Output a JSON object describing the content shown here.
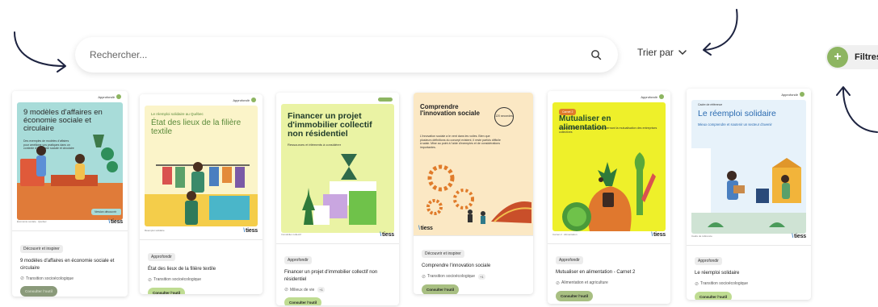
{
  "search": {
    "placeholder": "Rechercher..."
  },
  "sort": {
    "label": "Trier par"
  },
  "filters": {
    "label": "Filtres",
    "plus": "+"
  },
  "cards": [
    {
      "badge": "Approfondir",
      "cover_title": "9 modèles d'affaires en économie sociale et circulaire",
      "cover_sub": "Des exemples de modèles d'affaires pour améliorer vos pratiques dans un contexte d'économie sociale et circulaire",
      "cover_chip": "Version découvrir",
      "tag": "Découvrir et inspirer",
      "title": "9 modèles d'affaires en économie sociale et circulaire",
      "category": "Transition socioécologique",
      "cta": "Consulter l'outil"
    },
    {
      "badge": "Approfondir",
      "cover_kicker": "Le réemploi solidaire au Québec",
      "cover_title": "État des lieux de la filière textile",
      "tag": "Approfondir",
      "title": "État des lieux de la filière textile",
      "category": "Transition socioécologique",
      "cta": "Consulter l'outil"
    },
    {
      "cover_title": "Financer un projet d'immobilier collectif non résidentiel",
      "cover_sub": "Ressources et éléments à considérer",
      "tag": "Approfondir",
      "title": "Financer un projet d'immobilier collectif non résidentiel",
      "category": "Milieux de vie",
      "more": "+1",
      "cta": "Consulter l'outil"
    },
    {
      "cover_title": "Comprendre l'innovation sociale",
      "cover_stamp": "120 secondes",
      "cover_sub": "L'innovation sociale a le vent dans les voiles. Bien que plusieurs définitions du concept existent, il reste parfois difficile à saisir. Mise au point à l'aide d'exemples et de considérations importantes.",
      "tag": "Découvrir et inspirer",
      "title": "Comprendre l'innovation sociale",
      "category": "Transition socioécologique",
      "more": "+1",
      "cta": "Consulter l'outil"
    },
    {
      "badge": "Approfondir",
      "cover_chip": "Carnet 2",
      "cover_title": "Mutualiser en alimentation",
      "cover_sub": "Impacts positifs, freins et leviers concernant la mutualisation des entreprises collectives",
      "tag": "Approfondir",
      "title": "Mutualiser en alimentation - Carnet 2",
      "category": "Alimentation et agriculture",
      "cta": "Consulter l'outil"
    },
    {
      "badge": "Approfondir",
      "cover_kicker": "Cadre de référence",
      "cover_title": "Le réemploi solidaire",
      "cover_sub": "Mieux comprendre et soutenir un secteur d'avenir",
      "tag": "Approfondir",
      "title": "Le réemploi solidaire",
      "category": "Transition socioécologique",
      "cta": "Consulter l'outil"
    }
  ],
  "brand": "tiess",
  "colors": {
    "accent": "#8db561",
    "cta": "#bfdc92"
  }
}
